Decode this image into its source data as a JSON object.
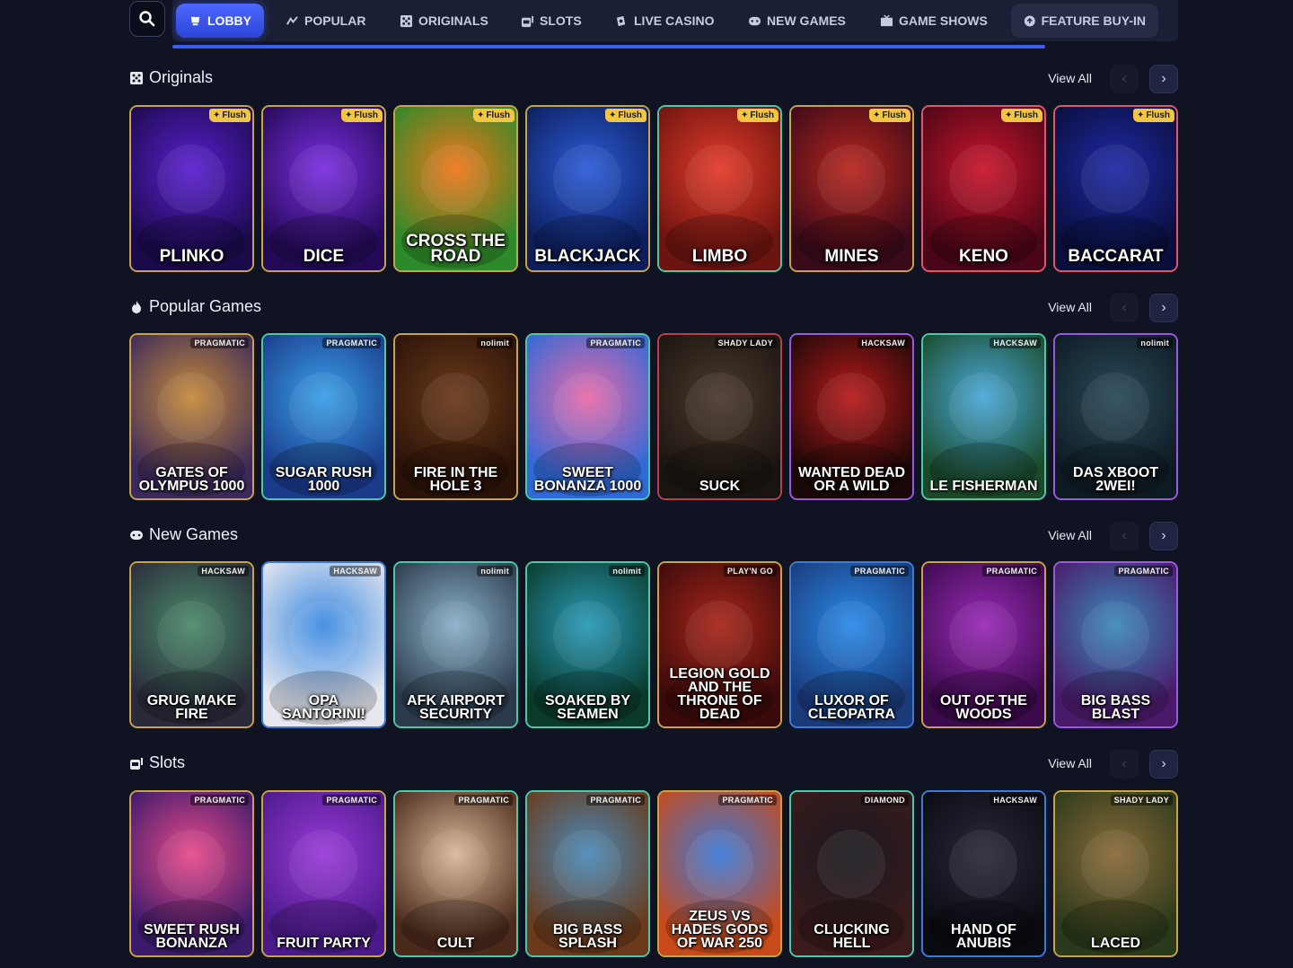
{
  "nav": {
    "tabs": [
      {
        "label": "LOBBY",
        "icon": "lobby-icon",
        "active": true
      },
      {
        "label": "POPULAR",
        "icon": "popular-icon"
      },
      {
        "label": "ORIGINALS",
        "icon": "originals-icon"
      },
      {
        "label": "SLOTS",
        "icon": "slots-icon"
      },
      {
        "label": "LIVE CASINO",
        "icon": "live-casino-icon"
      },
      {
        "label": "NEW GAMES",
        "icon": "new-games-icon"
      },
      {
        "label": "GAME SHOWS",
        "icon": "game-shows-icon"
      },
      {
        "label": "FEATURE BUY-IN",
        "icon": "feature-buy-in-icon"
      }
    ]
  },
  "sections": [
    {
      "title": "Originals",
      "icon": "originals-icon",
      "view_all": "View All",
      "games": [
        {
          "title": "PLINKO",
          "badge": "Flush",
          "colors": [
            "#5b1fd0",
            "#1a0a4a"
          ],
          "border": "#c9a348"
        },
        {
          "title": "DICE",
          "badge": "Flush",
          "colors": [
            "#7b2ee0",
            "#230a56"
          ],
          "border": "#c9a348"
        },
        {
          "title": "CROSS THE ROAD",
          "badge": "Flush",
          "colors": [
            "#f1761a",
            "#2d8a2a"
          ],
          "border": "#c9a348"
        },
        {
          "title": "BLACKJACK",
          "badge": "Flush",
          "colors": [
            "#2b5cd8",
            "#0d1e5c"
          ],
          "border": "#c9a348"
        },
        {
          "title": "LIMBO",
          "badge": "Flush",
          "colors": [
            "#e33b29",
            "#6c1410"
          ],
          "border": "#4dc8a8"
        },
        {
          "title": "MINES",
          "badge": "Flush",
          "colors": [
            "#b8261d",
            "#3a0a1a"
          ],
          "border": "#c9a348"
        },
        {
          "title": "KENO",
          "badge": "Flush",
          "colors": [
            "#c9152a",
            "#4a0618"
          ],
          "border": "#e0566a"
        },
        {
          "title": "BACCARAT",
          "badge": "Flush",
          "colors": [
            "#1e2aa6",
            "#0a0e3a"
          ],
          "border": "#e0566a"
        }
      ]
    },
    {
      "title": "Popular Games",
      "icon": "fire-icon",
      "view_all": "View All",
      "games": [
        {
          "title": "GATES OF OLYMPUS 1000",
          "provider": "PRAGMATIC",
          "colors": [
            "#c58a3a",
            "#3b2a5a"
          ],
          "border": "#c9a348"
        },
        {
          "title": "SUGAR RUSH 1000",
          "provider": "PRAGMATIC",
          "colors": [
            "#3ba0e8",
            "#1a3a8a"
          ],
          "border": "#4dc8a8"
        },
        {
          "title": "FIRE IN THE HOLE 3",
          "provider": "nolimit",
          "colors": [
            "#6a3a1a",
            "#2a1208"
          ],
          "border": "#c9a348"
        },
        {
          "title": "SWEET BONANZA 1000",
          "provider": "PRAGMATIC",
          "colors": [
            "#e86aa8",
            "#2e6ad8"
          ],
          "border": "#4dc8a8"
        },
        {
          "title": "SUCK",
          "provider": "SHADY LADY",
          "colors": [
            "#4a3a2e",
            "#1a1410"
          ],
          "border": "#b8404a"
        },
        {
          "title": "WANTED DEAD OR A WILD",
          "provider": "HACKSAW",
          "colors": [
            "#b81a1a",
            "#1a0808"
          ],
          "border": "#9a5ae0"
        },
        {
          "title": "LE FISHERMAN",
          "provider": "HACKSAW",
          "colors": [
            "#4aa8d8",
            "#1a4a2a"
          ],
          "border": "#4dc8a8"
        },
        {
          "title": "DAS XBOOT 2WEI!",
          "provider": "nolimit",
          "colors": [
            "#2a4a5a",
            "#0e1a22"
          ],
          "border": "#9a5ae0"
        }
      ]
    },
    {
      "title": "New Games",
      "icon": "new-games-icon",
      "view_all": "View All",
      "games": [
        {
          "title": "GRUG MAKE FIRE",
          "provider": "HACKSAW",
          "colors": [
            "#4a8a6a",
            "#2a2a3a"
          ],
          "border": "#c9a348"
        },
        {
          "title": "OPA SANTORINI!",
          "provider": "HACKSAW",
          "colors": [
            "#3a8ae0",
            "#e8e8f0"
          ],
          "border": "#3d7bd8"
        },
        {
          "title": "AFK AIRPORT SECURITY",
          "provider": "nolimit",
          "colors": [
            "#8ab0c8",
            "#2a3a4a"
          ],
          "border": "#4dc8a8"
        },
        {
          "title": "SOAKED BY SEAMEN",
          "provider": "nolimit",
          "colors": [
            "#2a9ab8",
            "#0a3a2a"
          ],
          "border": "#4dc8a8"
        },
        {
          "title": "LEGION GOLD AND THE THRONE OF DEAD",
          "provider": "PLAY'N GO",
          "colors": [
            "#a8261a",
            "#3a0a0a"
          ],
          "border": "#c9a348"
        },
        {
          "title": "LUXOR OF CLEOPATRA",
          "provider": "PRAGMATIC",
          "colors": [
            "#2a8ae8",
            "#1a3a7a"
          ],
          "border": "#3d7bd8"
        },
        {
          "title": "OUT OF THE WOODS",
          "provider": "PRAGMATIC",
          "colors": [
            "#9a2ab8",
            "#3a0a4a"
          ],
          "border": "#c9a348"
        },
        {
          "title": "BIG BASS BLAST",
          "provider": "PRAGMATIC",
          "colors": [
            "#3a8ab8",
            "#4a1a6a"
          ],
          "border": "#9a5ae0"
        }
      ]
    },
    {
      "title": "Slots",
      "icon": "slots-icon",
      "view_all": "View All",
      "games": [
        {
          "title": "SWEET RUSH BONANZA",
          "provider": "PRAGMATIC",
          "colors": [
            "#e84a8a",
            "#3a1a6a"
          ],
          "border": "#c9a348"
        },
        {
          "title": "FRUIT PARTY",
          "provider": "PRAGMATIC",
          "colors": [
            "#9a3ad8",
            "#4a1a8a"
          ],
          "border": "#c9a348"
        },
        {
          "title": "CULT",
          "provider": "PRAGMATIC",
          "colors": [
            "#d8b89a",
            "#4a2a1a"
          ],
          "border": "#4dc8a8"
        },
        {
          "title": "BIG BASS SPLASH",
          "provider": "PRAGMATIC",
          "colors": [
            "#4a8ab8",
            "#6a3a1a"
          ],
          "border": "#4dc8a8"
        },
        {
          "title": "ZEUS VS HADES GODS OF WAR 250",
          "provider": "PRAGMATIC",
          "colors": [
            "#3a7ad8",
            "#c84a1a"
          ],
          "border": "#c9a348"
        },
        {
          "title": "CLUCKING HELL",
          "provider": "DIAMOND",
          "colors": [
            "#1a1a22",
            "#3a1a1a"
          ],
          "border": "#4dc8a8"
        },
        {
          "title": "HAND OF ANUBIS",
          "provider": "HACKSAW",
          "colors": [
            "#2a2a3a",
            "#0a0a12"
          ],
          "border": "#3d7bd8"
        },
        {
          "title": "LACED",
          "provider": "SHADY LADY",
          "colors": [
            "#8a6a3a",
            "#2a3a1a"
          ],
          "border": "#c9a348"
        }
      ]
    }
  ]
}
